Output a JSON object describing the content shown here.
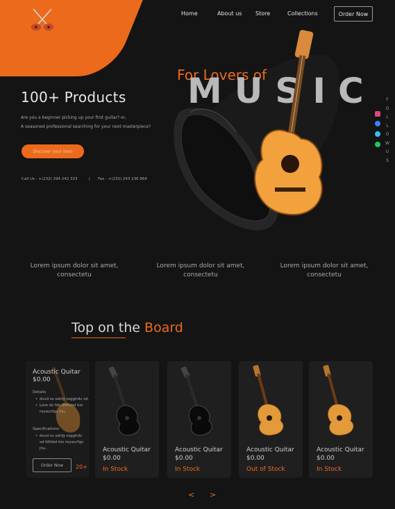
{
  "nav": {
    "links": [
      "Home",
      "About us",
      "Store",
      "Collections"
    ],
    "order_label": "Order Now"
  },
  "hero": {
    "title": "100+ Products",
    "desc_line1": "Are you a beginner picking up your first guitar?  or,",
    "desc_line2": "A seasoned professional searching for your next masterpiece?",
    "cta_label": "Discover your item",
    "phone": "Call Us - +(232) 294 242 323",
    "separator": "|",
    "fax": "Fax - +(232) 243 236 864",
    "tagline": "For Lovers of",
    "headline": "MUSIC"
  },
  "follow": {
    "letters": [
      "F",
      "O",
      "L",
      "L",
      "O",
      "W",
      "U",
      "S"
    ],
    "colors": [
      "#e0457b",
      "#3b82f6",
      "#38bdf8",
      "#22c55e"
    ],
    "icons": [
      "instagram-icon",
      "facebook-icon",
      "twitter-icon",
      "whatsapp-icon"
    ]
  },
  "features": [
    "Lorem ipsum dolor sit amet, consectetu",
    "Lorem ipsum dolor sit amet, consectetu",
    "Lorem ipsum dolor sit amet, consectetu"
  ],
  "section": {
    "title_plain": "Top on the ",
    "title_accent": "Board"
  },
  "featured": {
    "name": "Acoustic Quitar",
    "price": "$0.00",
    "details_label": "Details",
    "details": [
      "dsvd ss sskfg ssgghdv sd.",
      "Lore ds fds dfdfsbd kio reyaurfgs jhu."
    ],
    "specs_label": "Specifications",
    "specs": [
      "dsvd ss sskfg ssgghdv sd.fdfsbd kio reyaurfgs jhu."
    ],
    "order_label": "Order Now",
    "count": "20+"
  },
  "products": [
    {
      "name": "Acoustic Quitar",
      "price": "$0.00",
      "status": "In Stock",
      "style": "black"
    },
    {
      "name": "Acoustic Quitar",
      "price": "$0.00",
      "status": "In Stock",
      "style": "black"
    },
    {
      "name": "Acoustic Quitar",
      "price": "$0.00",
      "status": "Out of Stock",
      "style": "natural"
    },
    {
      "name": "Acoustic Quitar",
      "price": "$0.00",
      "status": "In Stock",
      "style": "natural"
    }
  ],
  "pager": {
    "prev": "<",
    "next": ">"
  },
  "colors": {
    "accent": "#ec6a1c",
    "background": "#141414",
    "card": "#1f1f1f"
  }
}
